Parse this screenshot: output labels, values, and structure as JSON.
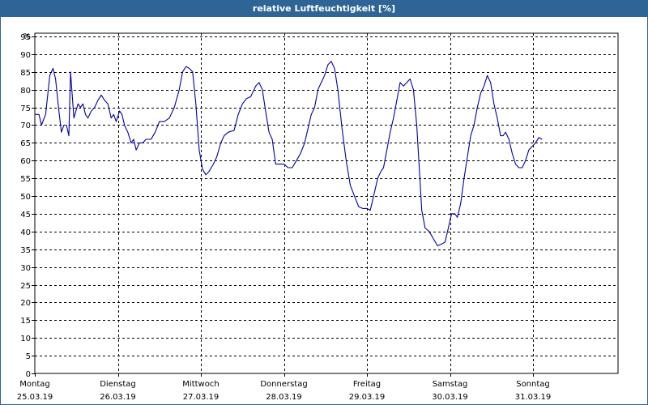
{
  "window": {
    "title": "relative Luftfeuchtigkeit [%]"
  },
  "chart_data": {
    "type": "line",
    "title": "relative Luftfeuchtigkeit [%]",
    "ylabel": "%",
    "xlabel": "",
    "ylim": [
      0,
      95
    ],
    "yticks": [
      0,
      5,
      10,
      15,
      20,
      25,
      30,
      35,
      40,
      45,
      50,
      55,
      60,
      65,
      70,
      75,
      80,
      85,
      90,
      95
    ],
    "xlim": [
      0,
      7
    ],
    "grid": true,
    "legend": "none",
    "line_color": "#0000a0",
    "x_ticks": [
      {
        "x": 0,
        "day": "Montag",
        "date": "25.03.19"
      },
      {
        "x": 1,
        "day": "Dienstag",
        "date": "26.03.19"
      },
      {
        "x": 2,
        "day": "Mittwoch",
        "date": "27.03.19"
      },
      {
        "x": 3,
        "day": "Donnerstag",
        "date": "28.03.19"
      },
      {
        "x": 4,
        "day": "Freitag",
        "date": "29.03.19"
      },
      {
        "x": 5,
        "day": "Samstag",
        "date": "30.03.19"
      },
      {
        "x": 6,
        "day": "Sonntag",
        "date": "31.03.19"
      }
    ],
    "series": [
      {
        "values": [
          [
            0.0,
            73
          ],
          [
            0.05,
            73
          ],
          [
            0.08,
            70
          ],
          [
            0.13,
            73
          ],
          [
            0.18,
            84
          ],
          [
            0.22,
            86
          ],
          [
            0.25,
            83
          ],
          [
            0.29,
            74
          ],
          [
            0.32,
            68
          ],
          [
            0.35,
            70
          ],
          [
            0.38,
            70
          ],
          [
            0.41,
            67
          ],
          [
            0.43,
            85
          ],
          [
            0.47,
            72
          ],
          [
            0.52,
            76
          ],
          [
            0.55,
            75
          ],
          [
            0.58,
            76
          ],
          [
            0.61,
            73
          ],
          [
            0.64,
            72
          ],
          [
            0.68,
            74
          ],
          [
            0.72,
            75
          ],
          [
            0.76,
            77
          ],
          [
            0.8,
            78.5
          ],
          [
            0.84,
            77
          ],
          [
            0.88,
            76
          ],
          [
            0.92,
            72
          ],
          [
            0.95,
            73
          ],
          [
            0.98,
            71
          ],
          [
            1.02,
            74
          ],
          [
            1.05,
            73
          ],
          [
            1.08,
            70
          ],
          [
            1.12,
            68
          ],
          [
            1.16,
            65
          ],
          [
            1.19,
            66
          ],
          [
            1.22,
            63
          ],
          [
            1.26,
            65
          ],
          [
            1.3,
            65
          ],
          [
            1.34,
            66
          ],
          [
            1.4,
            66
          ],
          [
            1.45,
            68
          ],
          [
            1.5,
            71
          ],
          [
            1.56,
            71
          ],
          [
            1.62,
            72
          ],
          [
            1.68,
            75
          ],
          [
            1.74,
            80
          ],
          [
            1.78,
            85
          ],
          [
            1.82,
            86.5
          ],
          [
            1.86,
            86
          ],
          [
            1.9,
            85
          ],
          [
            1.94,
            76
          ],
          [
            1.98,
            63
          ],
          [
            2.02,
            57.5
          ],
          [
            2.06,
            56
          ],
          [
            2.1,
            57
          ],
          [
            2.15,
            59
          ],
          [
            2.19,
            61
          ],
          [
            2.24,
            65
          ],
          [
            2.28,
            67
          ],
          [
            2.33,
            68
          ],
          [
            2.4,
            68.5
          ],
          [
            2.45,
            73
          ],
          [
            2.5,
            76
          ],
          [
            2.55,
            77.5
          ],
          [
            2.6,
            78
          ],
          [
            2.66,
            81
          ],
          [
            2.7,
            82
          ],
          [
            2.74,
            80
          ],
          [
            2.78,
            74
          ],
          [
            2.82,
            68
          ],
          [
            2.86,
            66
          ],
          [
            2.9,
            59
          ],
          [
            2.95,
            59
          ],
          [
            3.0,
            59
          ],
          [
            3.05,
            58
          ],
          [
            3.1,
            58
          ],
          [
            3.15,
            60
          ],
          [
            3.2,
            62
          ],
          [
            3.25,
            65
          ],
          [
            3.29,
            69
          ],
          [
            3.33,
            73
          ],
          [
            3.37,
            75
          ],
          [
            3.41,
            80
          ],
          [
            3.45,
            82
          ],
          [
            3.49,
            84
          ],
          [
            3.53,
            87
          ],
          [
            3.57,
            88
          ],
          [
            3.61,
            86
          ],
          [
            3.65,
            80
          ],
          [
            3.7,
            69
          ],
          [
            3.75,
            60
          ],
          [
            3.8,
            53
          ],
          [
            3.85,
            50
          ],
          [
            3.9,
            47
          ],
          [
            3.95,
            46.5
          ],
          [
            4.0,
            46.5
          ],
          [
            4.04,
            46
          ],
          [
            4.08,
            50
          ],
          [
            4.13,
            55
          ],
          [
            4.17,
            57
          ],
          [
            4.2,
            58
          ],
          [
            4.24,
            63
          ],
          [
            4.28,
            68
          ],
          [
            4.32,
            72
          ],
          [
            4.36,
            77
          ],
          [
            4.4,
            82
          ],
          [
            4.44,
            81
          ],
          [
            4.48,
            82
          ],
          [
            4.52,
            83
          ],
          [
            4.56,
            80
          ],
          [
            4.6,
            70
          ],
          [
            4.63,
            58
          ],
          [
            4.66,
            46
          ],
          [
            4.7,
            41
          ],
          [
            4.75,
            40
          ],
          [
            4.8,
            38
          ],
          [
            4.85,
            36
          ],
          [
            4.9,
            36.5
          ],
          [
            4.94,
            37
          ],
          [
            4.98,
            41
          ],
          [
            5.02,
            45
          ],
          [
            5.06,
            45
          ],
          [
            5.09,
            44
          ],
          [
            5.13,
            48
          ],
          [
            5.17,
            55
          ],
          [
            5.21,
            61
          ],
          [
            5.25,
            67
          ],
          [
            5.29,
            70
          ],
          [
            5.33,
            75
          ],
          [
            5.37,
            79
          ],
          [
            5.41,
            81
          ],
          [
            5.45,
            84
          ],
          [
            5.49,
            82
          ],
          [
            5.53,
            76
          ],
          [
            5.57,
            72
          ],
          [
            5.61,
            67
          ],
          [
            5.64,
            67
          ],
          [
            5.67,
            68
          ],
          [
            5.71,
            66
          ],
          [
            5.75,
            62
          ],
          [
            5.79,
            59
          ],
          [
            5.83,
            58
          ],
          [
            5.87,
            58
          ],
          [
            5.91,
            60
          ],
          [
            5.95,
            63
          ],
          [
            5.99,
            64
          ],
          [
            6.03,
            65
          ],
          [
            6.07,
            66.5
          ],
          [
            6.11,
            66
          ]
        ]
      }
    ]
  }
}
